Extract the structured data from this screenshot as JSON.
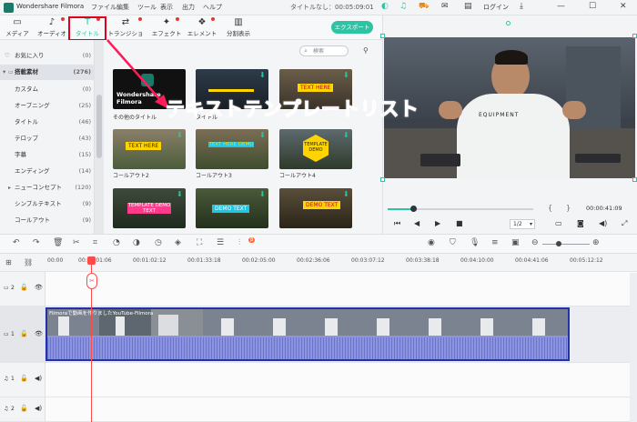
{
  "titlebar": {
    "app_name": "Wondershare Filmora",
    "menus": [
      "ファイル",
      "編集",
      "ツール",
      "表示",
      "出力",
      "ヘルプ"
    ],
    "project_title": "タイトルなし：00:05:09:01",
    "login_label": "ログイン"
  },
  "toolbar": {
    "tabs": [
      {
        "label": "メディア",
        "icon": "folder-icon"
      },
      {
        "label": "オーディオ",
        "icon": "music-note-icon"
      },
      {
        "label": "タイトル",
        "icon": "text-t-icon"
      },
      {
        "label": "トランジション",
        "icon": "transition-icon"
      },
      {
        "label": "エフェクト",
        "icon": "effects-icon"
      },
      {
        "label": "エレメント",
        "icon": "elements-icon"
      },
      {
        "label": "分割表示",
        "icon": "split-screen-icon"
      }
    ],
    "export_label": "エクスポート"
  },
  "sidebar": {
    "items": [
      {
        "label": "お気に入り",
        "count": "(0)"
      },
      {
        "label": "搭載素材",
        "count": "(276)"
      },
      {
        "label": "カスタム",
        "count": "(0)"
      },
      {
        "label": "オープニング",
        "count": "(25)"
      },
      {
        "label": "タイトル",
        "count": "(46)"
      },
      {
        "label": "テロップ",
        "count": "(43)"
      },
      {
        "label": "字幕",
        "count": "(15)"
      },
      {
        "label": "エンディング",
        "count": "(14)"
      },
      {
        "label": "ニューコンセプト",
        "count": "(120)"
      },
      {
        "label": "シンプルテキスト",
        "count": "(9)"
      },
      {
        "label": "コールアウト",
        "count": "(9)"
      }
    ]
  },
  "search": {
    "placeholder": "検索"
  },
  "templates": [
    {
      "caption": "その他のタイトル",
      "text": "Wondershare Filmora"
    },
    {
      "caption": "タイトル",
      "text": ""
    },
    {
      "caption": "コールアウト1",
      "text": "TEXT HERE"
    },
    {
      "caption": "コールアウト2",
      "text": "TEXT HERE"
    },
    {
      "caption": "コールアウト3",
      "text": "TEXT HERE DEMO"
    },
    {
      "caption": "コールアウト4",
      "text": "TEMPLATE DEMO"
    },
    {
      "caption": "",
      "text": "TEMPLATE DEMO TEXT"
    },
    {
      "caption": "",
      "text": "DEMO TEXT"
    },
    {
      "caption": "",
      "text": "DEMO TEXT"
    }
  ],
  "player": {
    "time": "00:00:41:09",
    "ratio": "1/2",
    "progress": 0.17,
    "preview_shirt_text": "EQUIPMENT"
  },
  "timeline": {
    "ruler_labels": [
      "00:00",
      "00:00:01:06",
      "00:01:02:12",
      "00:01:33:18",
      "00:02:05:00",
      "00:02:36:06",
      "00:03:07:12",
      "00:03:38:18",
      "00:04:10:00",
      "00:04:41:06",
      "00:05:12:12"
    ],
    "clip_title": "Filmoraで動画を作りましたYouTube-Filmora",
    "tracks": [
      {
        "label": "2"
      },
      {
        "label": "1"
      },
      {
        "label": "1"
      },
      {
        "label": "2"
      }
    ]
  },
  "annotation": {
    "text": "テキストテンプレートリスト"
  },
  "colors": {
    "accent": "#2ec4a3",
    "highlight": "#e0001a",
    "annotation": "#ff1a5a",
    "clip": "#8c94e0",
    "playhead": "#ff4a4a"
  }
}
